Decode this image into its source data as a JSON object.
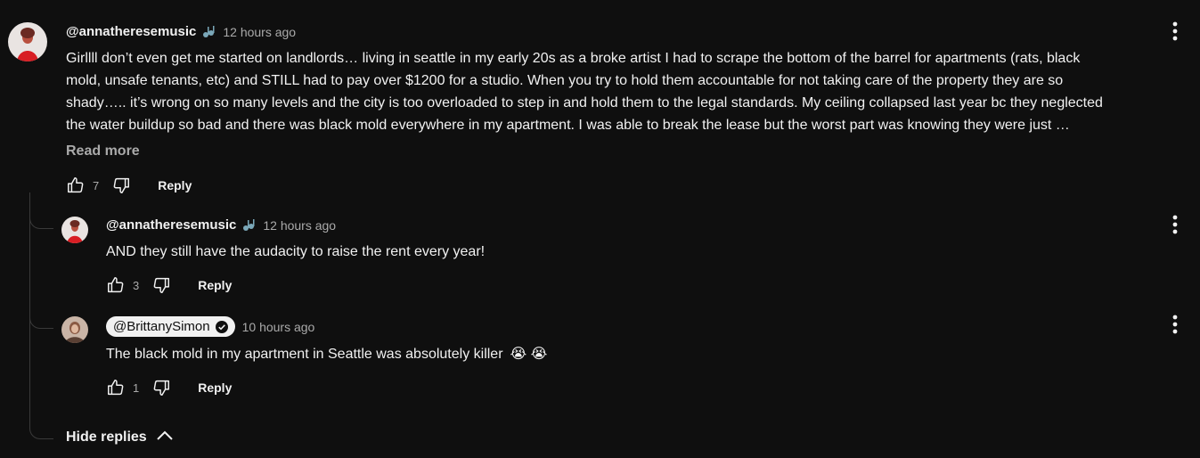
{
  "main_comment": {
    "author": "@annatheresemusic",
    "time": "12 hours ago",
    "text_lines": [
      "Girllll don’t even get me started on landlords… living in seattle in my early 20s as a broke artist I had to scrape the bottom of the barrel for apartments (rats, black",
      "mold, unsafe tenants, etc) and STILL had to pay over $1200 for a studio. When you try to hold them accountable for not taking care of the property they are so",
      "shady….. it’s wrong on so many levels and the city is too overloaded to step in and hold them to the legal standards. My ceiling collapsed last year bc they neglected",
      "the water buildup so bad and there was black mold everywhere in my apartment. I was able to break the lease but the worst part was knowing they were just …"
    ],
    "read_more": "Read more",
    "likes": "7",
    "reply_label": "Reply",
    "badge_icon": "music-note-badge-icon"
  },
  "replies": [
    {
      "author": "@annatheresemusic",
      "time": "12 hours ago",
      "text": "AND they still have the audacity to raise the rent every year!",
      "likes": "3",
      "reply_label": "Reply"
    },
    {
      "author": "@BrittanySimon",
      "time": "10 hours ago",
      "text": "The black mold in my apartment in Seattle was absolutely killer",
      "emoji": "😭 😭",
      "likes": "1",
      "reply_label": "Reply",
      "verified": true
    }
  ],
  "hide_replies": "Hide replies",
  "colors": {
    "background": "#0f0f0f",
    "text": "#f1f1f1",
    "secondary": "#aaaaaa",
    "creator_chip": "#f1f1f1"
  }
}
